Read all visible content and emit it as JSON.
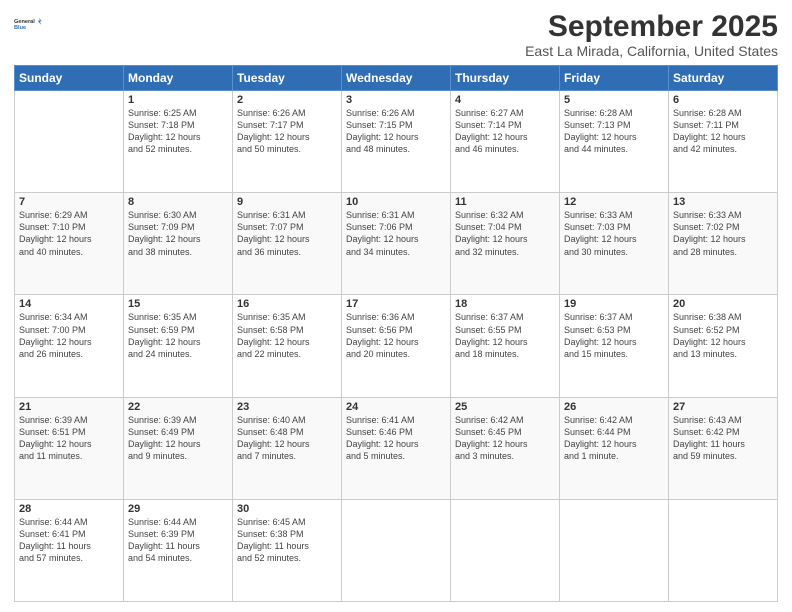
{
  "header": {
    "logo_line1": "General",
    "logo_line2": "Blue",
    "month": "September 2025",
    "location": "East La Mirada, California, United States"
  },
  "weekdays": [
    "Sunday",
    "Monday",
    "Tuesday",
    "Wednesday",
    "Thursday",
    "Friday",
    "Saturday"
  ],
  "weeks": [
    [
      {
        "day": "",
        "text": ""
      },
      {
        "day": "1",
        "text": "Sunrise: 6:25 AM\nSunset: 7:18 PM\nDaylight: 12 hours\nand 52 minutes."
      },
      {
        "day": "2",
        "text": "Sunrise: 6:26 AM\nSunset: 7:17 PM\nDaylight: 12 hours\nand 50 minutes."
      },
      {
        "day": "3",
        "text": "Sunrise: 6:26 AM\nSunset: 7:15 PM\nDaylight: 12 hours\nand 48 minutes."
      },
      {
        "day": "4",
        "text": "Sunrise: 6:27 AM\nSunset: 7:14 PM\nDaylight: 12 hours\nand 46 minutes."
      },
      {
        "day": "5",
        "text": "Sunrise: 6:28 AM\nSunset: 7:13 PM\nDaylight: 12 hours\nand 44 minutes."
      },
      {
        "day": "6",
        "text": "Sunrise: 6:28 AM\nSunset: 7:11 PM\nDaylight: 12 hours\nand 42 minutes."
      }
    ],
    [
      {
        "day": "7",
        "text": "Sunrise: 6:29 AM\nSunset: 7:10 PM\nDaylight: 12 hours\nand 40 minutes."
      },
      {
        "day": "8",
        "text": "Sunrise: 6:30 AM\nSunset: 7:09 PM\nDaylight: 12 hours\nand 38 minutes."
      },
      {
        "day": "9",
        "text": "Sunrise: 6:31 AM\nSunset: 7:07 PM\nDaylight: 12 hours\nand 36 minutes."
      },
      {
        "day": "10",
        "text": "Sunrise: 6:31 AM\nSunset: 7:06 PM\nDaylight: 12 hours\nand 34 minutes."
      },
      {
        "day": "11",
        "text": "Sunrise: 6:32 AM\nSunset: 7:04 PM\nDaylight: 12 hours\nand 32 minutes."
      },
      {
        "day": "12",
        "text": "Sunrise: 6:33 AM\nSunset: 7:03 PM\nDaylight: 12 hours\nand 30 minutes."
      },
      {
        "day": "13",
        "text": "Sunrise: 6:33 AM\nSunset: 7:02 PM\nDaylight: 12 hours\nand 28 minutes."
      }
    ],
    [
      {
        "day": "14",
        "text": "Sunrise: 6:34 AM\nSunset: 7:00 PM\nDaylight: 12 hours\nand 26 minutes."
      },
      {
        "day": "15",
        "text": "Sunrise: 6:35 AM\nSunset: 6:59 PM\nDaylight: 12 hours\nand 24 minutes."
      },
      {
        "day": "16",
        "text": "Sunrise: 6:35 AM\nSunset: 6:58 PM\nDaylight: 12 hours\nand 22 minutes."
      },
      {
        "day": "17",
        "text": "Sunrise: 6:36 AM\nSunset: 6:56 PM\nDaylight: 12 hours\nand 20 minutes."
      },
      {
        "day": "18",
        "text": "Sunrise: 6:37 AM\nSunset: 6:55 PM\nDaylight: 12 hours\nand 18 minutes."
      },
      {
        "day": "19",
        "text": "Sunrise: 6:37 AM\nSunset: 6:53 PM\nDaylight: 12 hours\nand 15 minutes."
      },
      {
        "day": "20",
        "text": "Sunrise: 6:38 AM\nSunset: 6:52 PM\nDaylight: 12 hours\nand 13 minutes."
      }
    ],
    [
      {
        "day": "21",
        "text": "Sunrise: 6:39 AM\nSunset: 6:51 PM\nDaylight: 12 hours\nand 11 minutes."
      },
      {
        "day": "22",
        "text": "Sunrise: 6:39 AM\nSunset: 6:49 PM\nDaylight: 12 hours\nand 9 minutes."
      },
      {
        "day": "23",
        "text": "Sunrise: 6:40 AM\nSunset: 6:48 PM\nDaylight: 12 hours\nand 7 minutes."
      },
      {
        "day": "24",
        "text": "Sunrise: 6:41 AM\nSunset: 6:46 PM\nDaylight: 12 hours\nand 5 minutes."
      },
      {
        "day": "25",
        "text": "Sunrise: 6:42 AM\nSunset: 6:45 PM\nDaylight: 12 hours\nand 3 minutes."
      },
      {
        "day": "26",
        "text": "Sunrise: 6:42 AM\nSunset: 6:44 PM\nDaylight: 12 hours\nand 1 minute."
      },
      {
        "day": "27",
        "text": "Sunrise: 6:43 AM\nSunset: 6:42 PM\nDaylight: 11 hours\nand 59 minutes."
      }
    ],
    [
      {
        "day": "28",
        "text": "Sunrise: 6:44 AM\nSunset: 6:41 PM\nDaylight: 11 hours\nand 57 minutes."
      },
      {
        "day": "29",
        "text": "Sunrise: 6:44 AM\nSunset: 6:39 PM\nDaylight: 11 hours\nand 54 minutes."
      },
      {
        "day": "30",
        "text": "Sunrise: 6:45 AM\nSunset: 6:38 PM\nDaylight: 11 hours\nand 52 minutes."
      },
      {
        "day": "",
        "text": ""
      },
      {
        "day": "",
        "text": ""
      },
      {
        "day": "",
        "text": ""
      },
      {
        "day": "",
        "text": ""
      }
    ]
  ]
}
